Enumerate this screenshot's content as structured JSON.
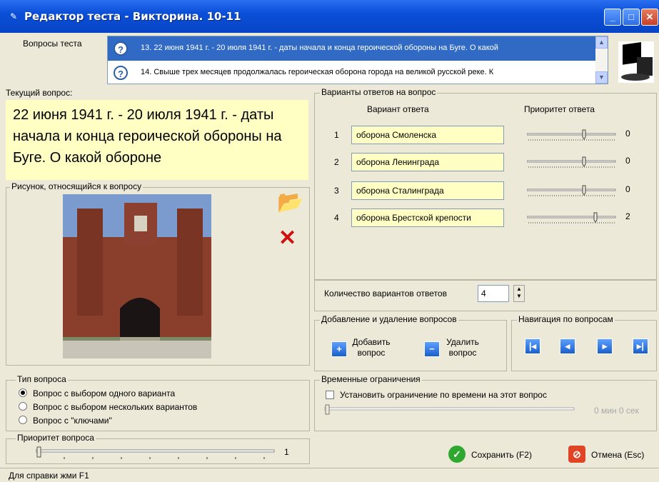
{
  "window": {
    "title": "Редактор теста - Викторина. 10-11"
  },
  "questions_panel": {
    "label": "Вопросы теста",
    "items": [
      "13. 22 июня 1941 г. - 20 июля 1941 г. - даты начала и конца героической обороны на Буге. О какой",
      "14. Свыше трех месяцев продолжалась героическая оборона города на великой русской реке. К"
    ]
  },
  "current_question": {
    "label": "Текущий вопрос:",
    "text": "22 июня 1941 г. - 20 июля 1941 г. - даты начала и конца героической обороны на Буге. О какой обороне"
  },
  "picture": {
    "label": "Рисунок, относящийся к вопросу"
  },
  "answers": {
    "label": "Варианты ответов на вопрос",
    "col_answer": "Вариант ответа",
    "col_priority": "Приоритет ответа",
    "rows": [
      {
        "num": "1",
        "text": "оборона Смоленска",
        "priority": "0"
      },
      {
        "num": "2",
        "text": "оборона Ленинграда",
        "priority": "0"
      },
      {
        "num": "3",
        "text": "оборона Сталинграда",
        "priority": "0"
      },
      {
        "num": "4",
        "text": "оборона Брестской крепости",
        "priority": "2"
      }
    ]
  },
  "variant_count": {
    "label": "Количество вариантов ответов",
    "value": "4"
  },
  "add_remove": {
    "label": "Добавление и удаление вопросов",
    "add": "Добавить\nвопрос",
    "remove": "Удалить\nвопрос"
  },
  "navigation": {
    "label": "Навигация по вопросам"
  },
  "question_type": {
    "label": "Тип вопроса",
    "options": [
      "Вопрос с выбором одного варианта",
      "Вопрос с выбором нескольких вариантов",
      "Вопрос с \"ключами\""
    ],
    "selected": 0
  },
  "question_priority": {
    "label": "Приоритет вопроса",
    "value": "1"
  },
  "time_limits": {
    "label": "Временные ограничения",
    "checkbox": "Установить ограничение по времени на этот вопрос",
    "readout": "0 мин 0 сек"
  },
  "buttons": {
    "save": "Сохранить (F2)",
    "cancel": "Отмена (Esc)"
  },
  "status": "Для справки жми F1"
}
